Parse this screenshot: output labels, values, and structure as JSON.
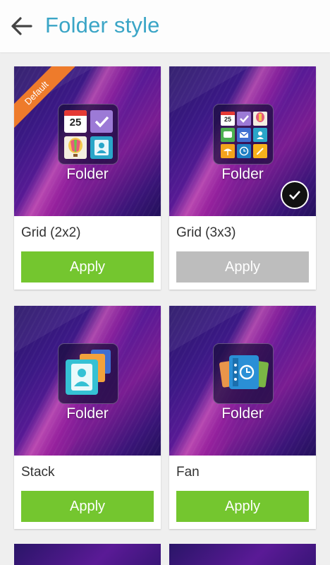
{
  "appbar": {
    "title": "Folder style",
    "back_icon": "arrow-left-icon"
  },
  "cards": [
    {
      "name": "Grid (2x2)",
      "apply_label": "Apply",
      "folder_label": "Folder",
      "badge": "Default",
      "applied": false
    },
    {
      "name": "Grid (3x3)",
      "apply_label": "Apply",
      "folder_label": "Folder",
      "selected_icon": "check-circle-icon",
      "applied": true
    },
    {
      "name": "Stack",
      "apply_label": "Apply",
      "folder_label": "Folder",
      "applied": false
    },
    {
      "name": "Fan",
      "apply_label": "Apply",
      "folder_label": "Folder",
      "applied": false
    }
  ],
  "calendar_day": "25",
  "colors": {
    "title": "#3aa5c6",
    "apply_active": "#74c62f",
    "apply_disabled": "#bdbdbd",
    "badge": "#ee7b2b"
  }
}
